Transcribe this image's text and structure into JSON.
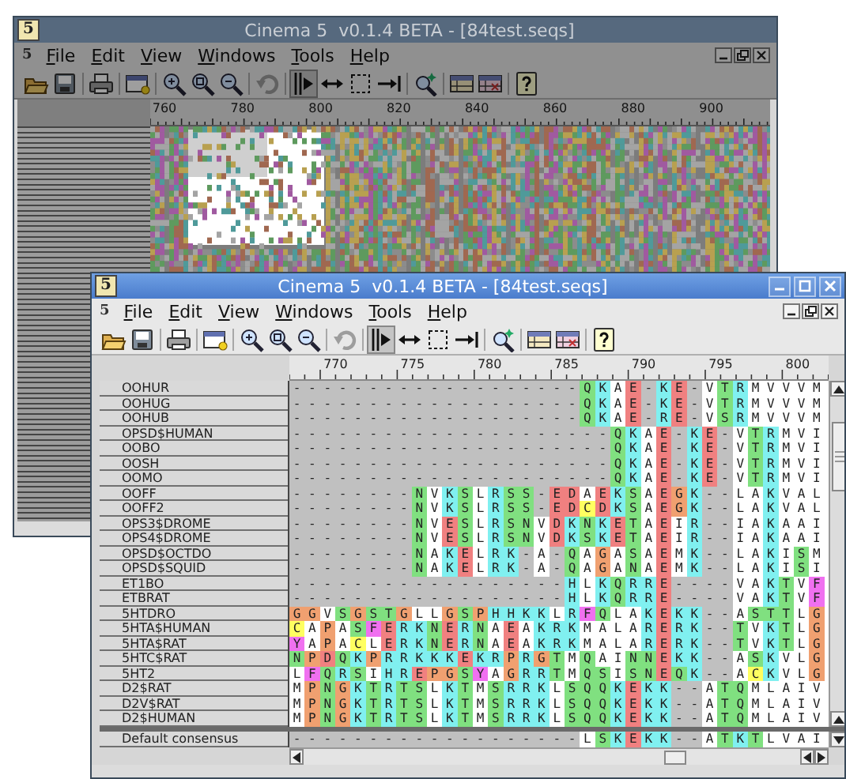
{
  "windows": [
    {
      "kind": "overview",
      "active": false,
      "title_icon": "5",
      "title": "Cinema 5  v0.1.4 BETA - [84test.seqs]",
      "menu_icon": "5",
      "menus": [
        "File",
        "Edit",
        "View",
        "Windows",
        "Tools",
        "Help"
      ],
      "toolbar": [
        {
          "kind": "open",
          "selected": false,
          "disabled": false
        },
        {
          "kind": "save",
          "selected": false,
          "disabled": false
        },
        {
          "kind": "separator"
        },
        {
          "kind": "print",
          "selected": false,
          "disabled": false
        },
        {
          "kind": "separator"
        },
        {
          "kind": "window",
          "selected": false,
          "disabled": false
        },
        {
          "kind": "separator"
        },
        {
          "kind": "zoomin",
          "selected": false,
          "disabled": false
        },
        {
          "kind": "zoomfit",
          "selected": false,
          "disabled": false
        },
        {
          "kind": "zoomout",
          "selected": false,
          "disabled": false
        },
        {
          "kind": "separator"
        },
        {
          "kind": "undo",
          "selected": false,
          "disabled": true
        },
        {
          "kind": "separator"
        },
        {
          "kind": "columns",
          "selected": true,
          "disabled": false
        },
        {
          "kind": "stretch",
          "selected": false,
          "disabled": false
        },
        {
          "kind": "marquee",
          "selected": false,
          "disabled": false
        },
        {
          "kind": "jump",
          "selected": false,
          "disabled": false
        },
        {
          "kind": "separator"
        },
        {
          "kind": "find",
          "selected": false,
          "disabled": false
        },
        {
          "kind": "separator"
        },
        {
          "kind": "panel",
          "selected": false,
          "disabled": false
        },
        {
          "kind": "panelx",
          "selected": false,
          "disabled": false
        },
        {
          "kind": "separator"
        },
        {
          "kind": "help",
          "selected": false,
          "disabled": false
        }
      ],
      "ruler": [
        "760",
        "780",
        "800",
        "820",
        "840",
        "860",
        "880",
        "900"
      ]
    },
    {
      "kind": "alignment",
      "active": true,
      "title_icon": "5",
      "title": "Cinema 5  v0.1.4 BETA - [84test.seqs]",
      "menu_icon": "5",
      "menus": [
        "File",
        "Edit",
        "View",
        "Windows",
        "Tools",
        "Help"
      ],
      "toolbar": [
        {
          "kind": "open",
          "selected": false,
          "disabled": false
        },
        {
          "kind": "save",
          "selected": false,
          "disabled": false
        },
        {
          "kind": "separator"
        },
        {
          "kind": "print",
          "selected": false,
          "disabled": false
        },
        {
          "kind": "separator"
        },
        {
          "kind": "window",
          "selected": false,
          "disabled": false
        },
        {
          "kind": "separator"
        },
        {
          "kind": "zoomin",
          "selected": false,
          "disabled": false
        },
        {
          "kind": "zoomfit",
          "selected": false,
          "disabled": false
        },
        {
          "kind": "zoomout",
          "selected": false,
          "disabled": false
        },
        {
          "kind": "separator"
        },
        {
          "kind": "undo",
          "selected": false,
          "disabled": true
        },
        {
          "kind": "separator"
        },
        {
          "kind": "columns",
          "selected": true,
          "disabled": false
        },
        {
          "kind": "stretch",
          "selected": false,
          "disabled": false
        },
        {
          "kind": "marquee",
          "selected": false,
          "disabled": false
        },
        {
          "kind": "jump",
          "selected": false,
          "disabled": false
        },
        {
          "kind": "separator"
        },
        {
          "kind": "find",
          "selected": false,
          "disabled": false
        },
        {
          "kind": "separator"
        },
        {
          "kind": "panel",
          "selected": false,
          "disabled": false
        },
        {
          "kind": "panelx",
          "selected": false,
          "disabled": false
        },
        {
          "kind": "separator"
        },
        {
          "kind": "help",
          "selected": false,
          "disabled": false
        }
      ],
      "ruler": [
        "770",
        "775",
        "780",
        "785",
        "790",
        "795",
        "800"
      ],
      "sequences": [
        {
          "name": "OOHUR",
          "residues": "-------------------QKAE-KE-VTRMVVVM"
        },
        {
          "name": "OOHUG",
          "residues": "-------------------QKAE-KE-VTRMVVVM"
        },
        {
          "name": "OOHUB",
          "residues": "-------------------QKAE-RE-VSRMVVVM"
        },
        {
          "name": "OPSD$HUMAN",
          "residues": "---------------------QKAE-KE-VTRMVI"
        },
        {
          "name": "OOBO",
          "residues": "---------------------QKAE-KE-VTRMVI"
        },
        {
          "name": "OOSH",
          "residues": "---------------------QKAE-KE-VTRMVI"
        },
        {
          "name": "OOMO",
          "residues": "---------------------QKAE-KE-VTRMVI"
        },
        {
          "name": "OOFF",
          "residues": "--------NVKSLRSS-EDAEKSAEGK--LAKVAL"
        },
        {
          "name": "OOFF2",
          "residues": "--------NVKSLRSS-EDCDKSAEGK--LAKVAL"
        },
        {
          "name": "OPS3$DROME",
          "residues": "--------NVESLRSNVDKNKETAEIR--IAKAAI"
        },
        {
          "name": "OPS4$DROME",
          "residues": "--------NVESLRSNVDKSKETAEIR--IAKAAI"
        },
        {
          "name": "OPSD$OCTDO",
          "residues": "--------NAKELRK-A-QAGASAEMK--LAKISM"
        },
        {
          "name": "OPSD$SQUID",
          "residues": "--------NAKELRK-A-QAGANAEMK--LAKISI"
        },
        {
          "name": "ET1BO",
          "residues": "------------------HLKQRRE----VAKTVF"
        },
        {
          "name": "ETBRAT",
          "residues": "------------------HLKQRRE----VAKTVF"
        },
        {
          "name": "5HTDRO",
          "residues": "GGVSGSTGLLGSPHHKKLRFQLAKEKK--ASTTLG"
        },
        {
          "name": "5HTA$HUMAN",
          "residues": "CAPASFERKNERNAEAKRKMALARERK--TVKTLG"
        },
        {
          "name": "5HTA$RAT",
          "residues": "YAPACLERKNERNAEAKRKMALARERK--TVKTLG"
        },
        {
          "name": "5HTC$RAT",
          "residues": "NPDQKPRRKKKEKRPRGTMQAINNEKK--ASKVLG"
        },
        {
          "name": "5HT2",
          "residues": "LFQRSIHREPGSYAGRRTMQSISNEQK--ACKVLG"
        },
        {
          "name": "D2$RAT",
          "residues": "MPNGKTRTSLKTMSRRKLSQQKEKK--ATQMLAIV"
        },
        {
          "name": "D2V$RAT",
          "residues": "MPNGKTRTSLKTMSRRKLSQQKEKK--ATQMLAIV"
        },
        {
          "name": "D2$HUMAN",
          "residues": "MPNGKTRTSLKTMSRRKLSQQKEKK--ATQMLAIV"
        }
      ],
      "consensus": {
        "name": "Default consensus",
        "residues": "-------------------LSKEKK--ATKTLVAI"
      }
    }
  ]
}
